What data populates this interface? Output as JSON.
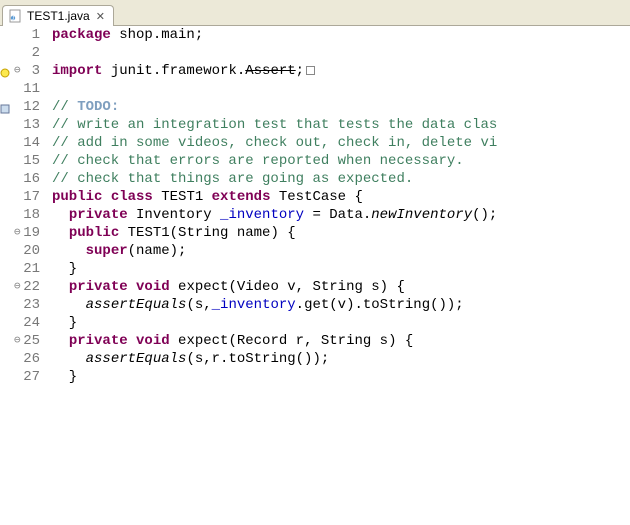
{
  "tab": {
    "filename": "TEST1.java",
    "close_glyph": "✕"
  },
  "lines": [
    {
      "n": "1",
      "marks": "",
      "tokens": [
        [
          "kw",
          "package"
        ],
        [
          "",
          " shop.main;"
        ]
      ]
    },
    {
      "n": "2",
      "marks": "",
      "tokens": [
        [
          "",
          ""
        ]
      ]
    },
    {
      "n": "3",
      "marks": "wf",
      "tokens": [
        [
          "kw",
          "import"
        ],
        [
          "",
          " junit.framework."
        ],
        [
          "deprecated",
          "Assert"
        ],
        [
          "",
          ";"
        ],
        [
          "fold",
          ""
        ]
      ]
    },
    {
      "n": "11",
      "marks": "",
      "tokens": [
        [
          "",
          ""
        ]
      ]
    },
    {
      "n": "12",
      "marks": "t",
      "tokens": [
        [
          "com",
          "// "
        ],
        [
          "todo",
          "TODO:"
        ]
      ]
    },
    {
      "n": "13",
      "marks": "",
      "tokens": [
        [
          "com",
          "// write an integration test that tests the data clas"
        ]
      ]
    },
    {
      "n": "14",
      "marks": "",
      "tokens": [
        [
          "com",
          "// add in some videos, check out, check in, delete vi"
        ]
      ]
    },
    {
      "n": "15",
      "marks": "",
      "tokens": [
        [
          "com",
          "// check that errors are reported when necessary."
        ]
      ]
    },
    {
      "n": "16",
      "marks": "",
      "tokens": [
        [
          "com",
          "// check that things are going as expected."
        ]
      ]
    },
    {
      "n": "17",
      "marks": "",
      "tokens": [
        [
          "kw",
          "public"
        ],
        [
          "",
          " "
        ],
        [
          "kw",
          "class"
        ],
        [
          "",
          " TEST1 "
        ],
        [
          "kw",
          "extends"
        ],
        [
          "",
          " TestCase {"
        ]
      ]
    },
    {
      "n": "18",
      "marks": "",
      "tokens": [
        [
          "",
          "  "
        ],
        [
          "kw",
          "private"
        ],
        [
          "",
          " Inventory "
        ],
        [
          "field",
          "_inventory"
        ],
        [
          "",
          " = Data."
        ],
        [
          "static-it",
          "newInventory"
        ],
        [
          "",
          "();"
        ]
      ]
    },
    {
      "n": "19",
      "marks": "m",
      "tokens": [
        [
          "",
          "  "
        ],
        [
          "kw",
          "public"
        ],
        [
          "",
          " TEST1(String name) {"
        ]
      ]
    },
    {
      "n": "20",
      "marks": "",
      "tokens": [
        [
          "",
          "    "
        ],
        [
          "kw",
          "super"
        ],
        [
          "",
          "(name);"
        ]
      ]
    },
    {
      "n": "21",
      "marks": "",
      "tokens": [
        [
          "",
          "  }"
        ]
      ]
    },
    {
      "n": "22",
      "marks": "m",
      "tokens": [
        [
          "",
          "  "
        ],
        [
          "kw",
          "private"
        ],
        [
          "",
          " "
        ],
        [
          "kw",
          "void"
        ],
        [
          "",
          " expect(Video v, String s) {"
        ]
      ]
    },
    {
      "n": "23",
      "marks": "",
      "tokens": [
        [
          "",
          "    "
        ],
        [
          "static-it",
          "assertEquals"
        ],
        [
          "",
          "(s,"
        ],
        [
          "field",
          "_inventory"
        ],
        [
          "",
          ".get(v).toString());"
        ]
      ]
    },
    {
      "n": "24",
      "marks": "",
      "tokens": [
        [
          "",
          "  }"
        ]
      ]
    },
    {
      "n": "25",
      "marks": "m",
      "tokens": [
        [
          "",
          "  "
        ],
        [
          "kw",
          "private"
        ],
        [
          "",
          " "
        ],
        [
          "kw",
          "void"
        ],
        [
          "",
          " expect(Record r, String s) {"
        ]
      ]
    },
    {
      "n": "26",
      "marks": "",
      "tokens": [
        [
          "",
          "    "
        ],
        [
          "static-it",
          "assertEquals"
        ],
        [
          "",
          "(s,r.toString());"
        ]
      ]
    },
    {
      "n": "27",
      "marks": "",
      "tokens": [
        [
          "",
          "  }"
        ]
      ]
    }
  ]
}
